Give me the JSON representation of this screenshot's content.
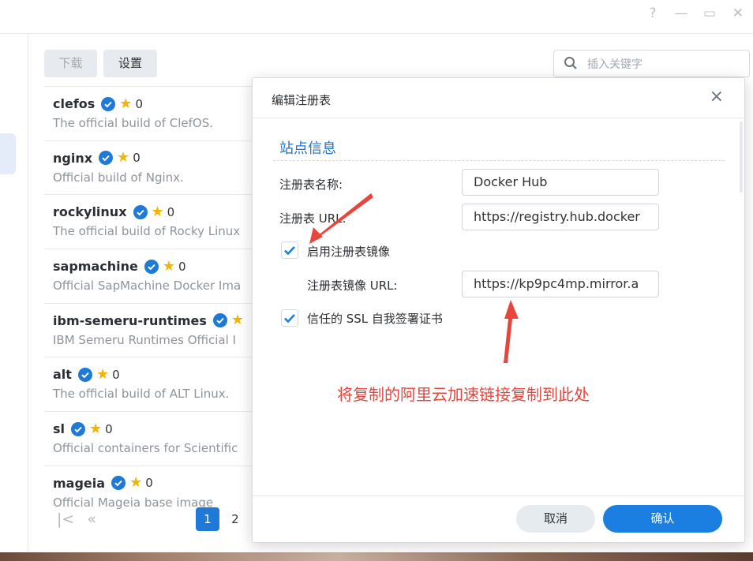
{
  "window": {
    "controls": {
      "help": "?",
      "minimize": "—",
      "maximize": "▭",
      "close": "✕"
    }
  },
  "toolbar": {
    "download_label": "下载",
    "settings_label": "设置",
    "search_placeholder": "插入关键字"
  },
  "registry_list": [
    {
      "name": "clefos",
      "stars": "0",
      "description": "The official build of ClefOS."
    },
    {
      "name": "nginx",
      "stars": "0",
      "description": "Official build of Nginx."
    },
    {
      "name": "rockylinux",
      "stars": "0",
      "description": "The official build of Rocky Linux"
    },
    {
      "name": "sapmachine",
      "stars": "0",
      "description": "Official SapMachine Docker Ima"
    },
    {
      "name": "ibm-semeru-runtimes",
      "stars": "",
      "description": "IBM Semeru Runtimes Official I"
    },
    {
      "name": "alt",
      "stars": "0",
      "description": "The official build of ALT Linux."
    },
    {
      "name": "sl",
      "stars": "0",
      "description": "Official containers for Scientific"
    },
    {
      "name": "mageia",
      "stars": "0",
      "description": "Official Mageia base image"
    }
  ],
  "pager": {
    "first": "|<",
    "prev": "«",
    "page1": "1",
    "page2": "2"
  },
  "dialog": {
    "title": "编辑注册表",
    "close": "×",
    "section_title": "站点信息",
    "registry_name_label": "注册表名称:",
    "registry_name_value": "Docker Hub",
    "registry_url_label": "注册表 URL:",
    "registry_url_value": "https://registry.hub.docker",
    "enable_mirror_label": "启用注册表镜像",
    "enable_mirror_checked": true,
    "mirror_url_label": "注册表镜像 URL:",
    "mirror_url_value": "https://kp9pc4mp.mirror.a",
    "trust_ssl_label": "信任的 SSL 自我签署证书",
    "trust_ssl_checked": true,
    "cancel_label": "取消",
    "ok_label": "确认"
  },
  "annotation": {
    "note": "将复制的阿里云加速链接复制到此处",
    "color": "#e8453c"
  },
  "colors": {
    "accent": "#1a7fe0",
    "verified": "#1e7ad6",
    "star": "#f4b400"
  }
}
